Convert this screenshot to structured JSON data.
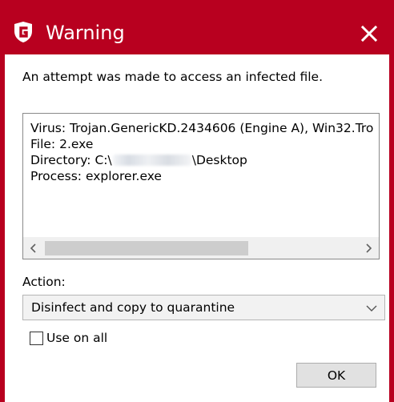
{
  "window": {
    "title": "Warning",
    "brand_color": "#b8001f",
    "logo_icon": "g-data-shield-logo",
    "close_icon": "close-x-icon"
  },
  "message": "An attempt was made to access an infected file.",
  "details": {
    "virus_line": "Virus: Trojan.GenericKD.2434606 (Engine A), Win32.Tro",
    "file_line": "File: 2.exe",
    "directory_prefix": "Directory: C:\\",
    "directory_suffix": "\\Desktop",
    "process_line": "Process: explorer.exe",
    "scrollbar": {
      "left_arrow": "<",
      "right_arrow": ">"
    }
  },
  "action": {
    "label": "Action:",
    "selected": "Disinfect and copy to quarantine"
  },
  "use_on_all": {
    "label": "Use on all",
    "checked": false
  },
  "ok_button": {
    "label": "OK"
  }
}
